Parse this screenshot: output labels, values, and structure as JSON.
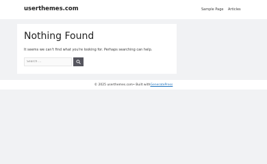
{
  "header": {
    "site_title": "userthemes.com",
    "nav": [
      {
        "label": "Sample Page"
      },
      {
        "label": "Articles"
      }
    ]
  },
  "main": {
    "title": "Nothing Found",
    "message": "It seems we can't find what you're looking for. Perhaps searching can help.",
    "search": {
      "placeholder": "Search ...",
      "button_icon": "search-icon"
    }
  },
  "footer": {
    "copyright": "© 2025 userthemes.com",
    "separator": " • Built with ",
    "builder_link": "GeneratePress"
  },
  "colors": {
    "page_bg": "#f1f2f4",
    "surface": "#ffffff",
    "button_bg": "#55555e",
    "link": "#1e73be"
  }
}
